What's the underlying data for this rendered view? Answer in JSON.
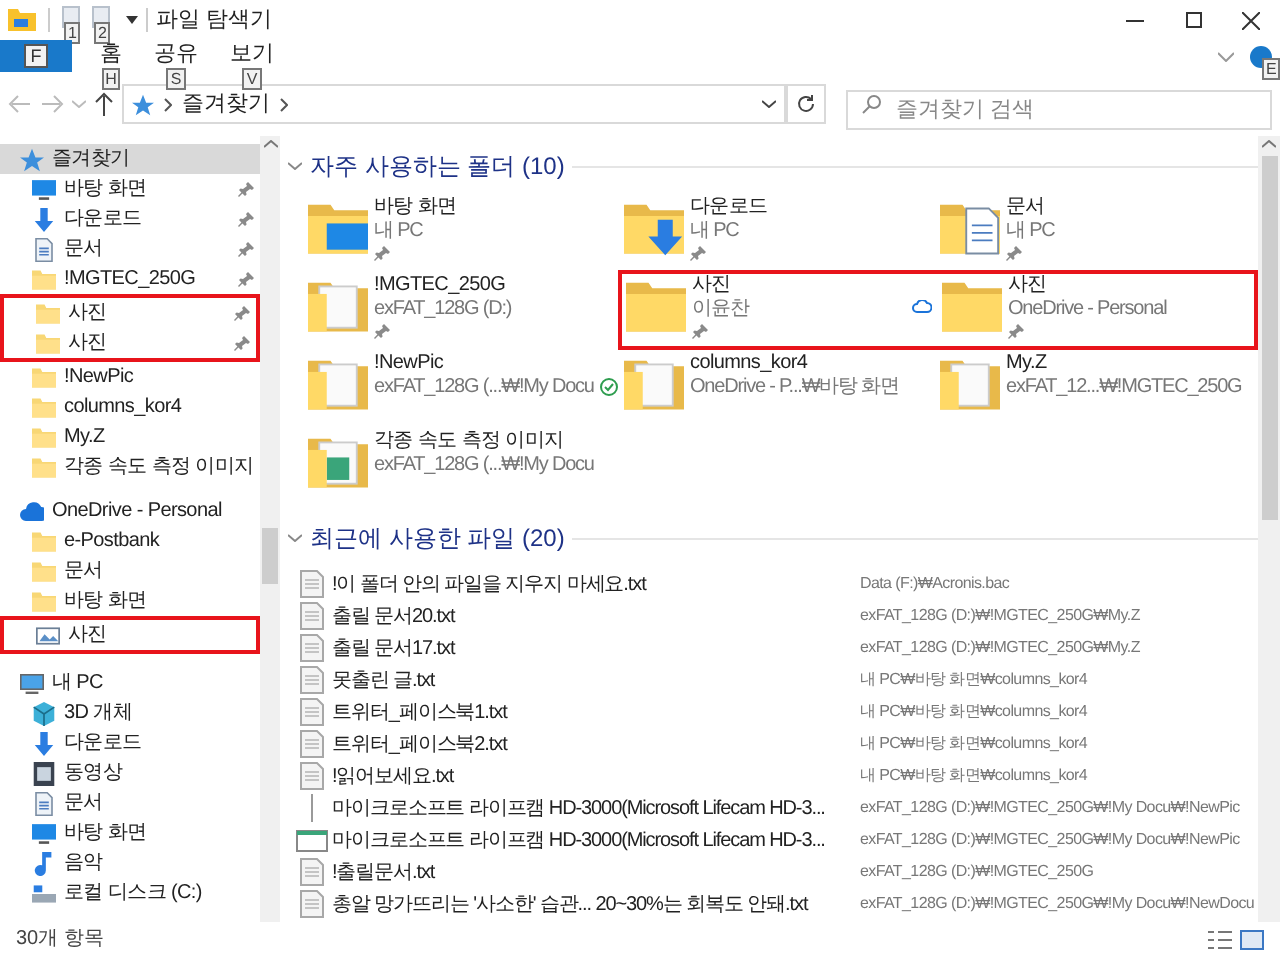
{
  "window": {
    "title": "파일 탐색기",
    "qat_keytips": [
      "1",
      "2"
    ]
  },
  "ribbon": {
    "tabs": [
      {
        "label": "F",
        "kind": "file",
        "selected": true
      },
      {
        "label": "홈",
        "kind": "tab",
        "selected": false,
        "keytip": "H"
      },
      {
        "label": "공유",
        "kind": "tab",
        "selected": false,
        "keytip": "S"
      },
      {
        "label": "보기",
        "kind": "tab",
        "selected": false,
        "keytip": "V"
      }
    ],
    "help_keytip": "E"
  },
  "address_bar": {
    "path": [
      "즐겨찾기"
    ],
    "search_placeholder": "즐겨찾기 검색"
  },
  "sidebar": {
    "items": [
      {
        "label": "즐겨찾기",
        "kind": "star",
        "selected": true,
        "children": [
          {
            "label": "바탕 화면",
            "kind": "desktop",
            "pinned": true,
            "highlighted": false
          },
          {
            "label": "다운로드",
            "kind": "download",
            "pinned": true,
            "highlighted": false
          },
          {
            "label": "문서",
            "kind": "document",
            "pinned": true,
            "highlighted": false
          },
          {
            "label": "!MGTEC_250G",
            "kind": "folder",
            "pinned": true,
            "highlighted": false
          },
          {
            "label": "사진",
            "kind": "folder",
            "pinned": true,
            "highlighted": true
          },
          {
            "label": "사진",
            "kind": "folder",
            "pinned": true,
            "highlighted": true
          },
          {
            "label": "!NewPic",
            "kind": "folder",
            "pinned": false,
            "highlighted": false
          },
          {
            "label": "columns_kor4",
            "kind": "folder",
            "pinned": false,
            "highlighted": false
          },
          {
            "label": "My.Z",
            "kind": "folder",
            "pinned": false,
            "highlighted": false
          },
          {
            "label": "각종 속도 측정 이미지",
            "kind": "folder",
            "pinned": false,
            "highlighted": false
          }
        ]
      },
      {
        "label": "OneDrive - Personal",
        "kind": "cloud",
        "selected": false,
        "children": [
          {
            "label": "e-Postbank",
            "kind": "folder",
            "highlighted": false
          },
          {
            "label": "문서",
            "kind": "folder",
            "highlighted": false
          },
          {
            "label": "바탕 화면",
            "kind": "folder",
            "highlighted": false
          },
          {
            "label": "사진",
            "kind": "pictures",
            "highlighted": true
          }
        ]
      },
      {
        "label": "내 PC",
        "kind": "pc",
        "selected": false,
        "children": [
          {
            "label": "3D 개체",
            "kind": "cube"
          },
          {
            "label": "다운로드",
            "kind": "download"
          },
          {
            "label": "동영상",
            "kind": "video"
          },
          {
            "label": "문서",
            "kind": "document"
          },
          {
            "label": "바탕 화면",
            "kind": "desktop"
          },
          {
            "label": "음악",
            "kind": "music"
          },
          {
            "label": "로컬 디스크 (C:)",
            "kind": "drive"
          }
        ]
      }
    ]
  },
  "frequent_folders": {
    "title": "자주 사용하는 폴더 (10)",
    "expanded": true,
    "rows": [
      [
        {
          "name": "바탕 화면",
          "location": "내 PC",
          "kind": "desktop",
          "pinned": true,
          "cloud_only": false,
          "synced": false,
          "highlighted": false
        },
        {
          "name": "다운로드",
          "location": "내 PC",
          "kind": "download",
          "pinned": true,
          "cloud_only": false,
          "synced": false,
          "highlighted": false
        },
        {
          "name": "문서",
          "location": "내 PC",
          "kind": "document",
          "pinned": true,
          "cloud_only": false,
          "synced": false,
          "highlighted": false
        }
      ],
      [
        {
          "name": "!MGTEC_250G",
          "location": "exFAT_128G (D:)",
          "kind": "folder-pages",
          "pinned": true,
          "cloud_only": false,
          "synced": false,
          "highlighted": false
        },
        {
          "name": "사진",
          "location": "이윤찬",
          "kind": "folder",
          "pinned": true,
          "cloud_only": true,
          "synced": false,
          "highlighted": true
        },
        {
          "name": "사진",
          "location": "OneDrive - Personal",
          "kind": "folder",
          "pinned": true,
          "cloud_only": false,
          "synced": false,
          "highlighted": true
        }
      ],
      [
        {
          "name": "!NewPic",
          "location": "exFAT_128G (...₩!My Docu",
          "kind": "folder-pages",
          "pinned": false,
          "cloud_only": false,
          "synced": true,
          "highlighted": false
        },
        {
          "name": "columns_kor4",
          "location": "OneDrive - P...₩바탕 화면",
          "kind": "folder-pages",
          "pinned": false,
          "cloud_only": false,
          "synced": false,
          "highlighted": false
        },
        {
          "name": "My.Z",
          "location": "exFAT_12...₩!MGTEC_250G",
          "kind": "folder-pages",
          "pinned": false,
          "cloud_only": false,
          "synced": false,
          "highlighted": false
        }
      ],
      [
        {
          "name": "각종 속도 측정 이미지",
          "location": "exFAT_128G (...₩!My Docu",
          "kind": "folder-image",
          "pinned": false,
          "cloud_only": false,
          "synced": false,
          "highlighted": false
        }
      ]
    ]
  },
  "recent_files": {
    "title": "최근에 사용한 파일 (20)",
    "expanded": true,
    "files": [
      {
        "name": "!이 폴더 안의 파일을 지우지 마세요.txt",
        "path": "Data (F:)₩Acronis.bac",
        "kind": "text"
      },
      {
        "name": "출릴 문서20.txt",
        "path": "exFAT_128G (D:)₩!MGTEC_250G₩My.Z",
        "kind": "text"
      },
      {
        "name": "출릴 문서17.txt",
        "path": "exFAT_128G (D:)₩!MGTEC_250G₩My.Z",
        "kind": "text"
      },
      {
        "name": "못출린 글.txt",
        "path": "내 PC₩바탕 화면₩columns_kor4",
        "kind": "text"
      },
      {
        "name": "트위터_페이스북1.txt",
        "path": "내 PC₩바탕 화면₩columns_kor4",
        "kind": "text"
      },
      {
        "name": "트위터_페이스북2.txt",
        "path": "내 PC₩바탕 화면₩columns_kor4",
        "kind": "text"
      },
      {
        "name": "!읽어보세요.txt",
        "path": "내 PC₩바탕 화면₩columns_kor4",
        "kind": "text"
      },
      {
        "name": "마이크로소프트 라이프캠 HD-3000(Microsoft Lifecam HD-3...",
        "path": "exFAT_128G (D:)₩!MGTEC_250G₩!My Docu₩!NewPic",
        "kind": "line"
      },
      {
        "name": "마이크로소프트 라이프캠 HD-3000(Microsoft Lifecam HD-3...",
        "path": "exFAT_128G (D:)₩!MGTEC_250G₩!My Docu₩!NewPic",
        "kind": "image"
      },
      {
        "name": "!출릴문서.txt",
        "path": "exFAT_128G (D:)₩!MGTEC_250G",
        "kind": "text"
      },
      {
        "name": "총알 망가뜨리는 '사소한' 습관... 20~30%는 회복도 안돼.txt",
        "path": "exFAT_128G (D:)₩!MGTEC_250G₩!My Docu₩!NewDocu",
        "kind": "text"
      }
    ]
  },
  "status_bar": {
    "item_count": "30개 항목"
  }
}
